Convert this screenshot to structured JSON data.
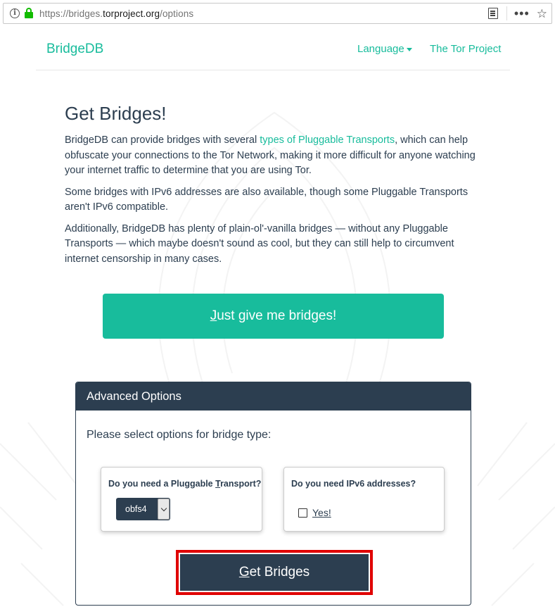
{
  "browser": {
    "url_prefix": "https://bridges.",
    "url_host": "torproject.org",
    "url_path": "/options",
    "info_icon": "i",
    "more_icon": "•••",
    "star_icon": "☆"
  },
  "navbar": {
    "brand": "BridgeDB",
    "language": "Language",
    "tor_project": "The Tor Project"
  },
  "main": {
    "title": "Get Bridges!",
    "p1_before": "BridgeDB can provide bridges with several ",
    "p1_link": "types of Pluggable Transports",
    "p1_after": ", which can help obfuscate your connections to the Tor Network, making it more difficult for anyone watching your internet traffic to determine that you are using Tor.",
    "p2": "Some bridges with IPv6 addresses are also available, though some Pluggable Transports aren't IPv6 compatible.",
    "p3": "Additionally, BridgeDB has plenty of plain-ol'-vanilla bridges — without any Pluggable Transports — which maybe doesn't sound as cool, but they can still help to circumvent internet censorship in many cases.",
    "just_give_first": "J",
    "just_give_rest": "ust give me bridges!"
  },
  "advanced": {
    "heading": "Advanced Options",
    "subheading": "Please select options for bridge type:",
    "pt_question_before": "Do you need a Pluggable ",
    "pt_question_u": "T",
    "pt_question_after": "ransport?",
    "pt_selected": "obfs4",
    "ipv6_question": "Do you need IPv6 addresses?",
    "ipv6_label": "Yes!",
    "ipv6_checked": false,
    "get_first": "G",
    "get_rest": "et Bridges"
  },
  "colors": {
    "accent": "#18bc9c",
    "dark": "#2c3e50",
    "highlight": "#e00000",
    "lock": "#12bc00"
  }
}
